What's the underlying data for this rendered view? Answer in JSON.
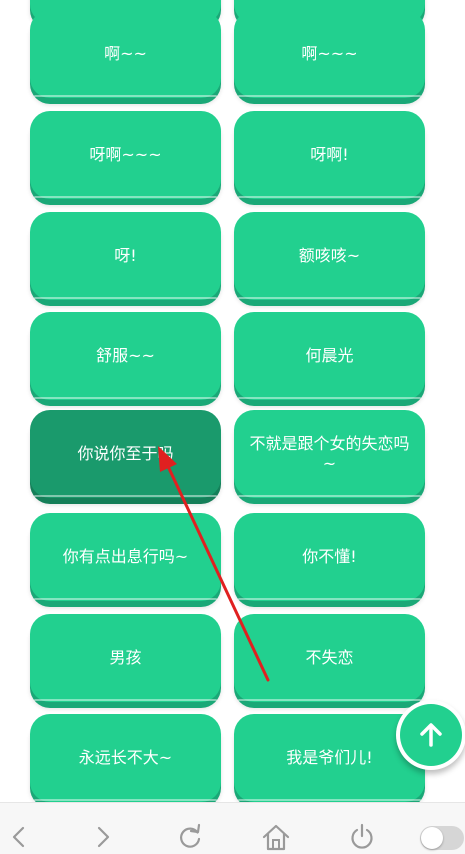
{
  "buttons": [
    {
      "label": ""
    },
    {
      "label": ""
    },
    {
      "label": "啊~~"
    },
    {
      "label": "啊~~~"
    },
    {
      "label": "呀啊~~~"
    },
    {
      "label": "呀啊!"
    },
    {
      "label": "呀!"
    },
    {
      "label": "额咳咳~"
    },
    {
      "label": "舒服~~"
    },
    {
      "label": "何晨光"
    },
    {
      "label": "你说你至于吗"
    },
    {
      "label": "不就是跟个女的失恋吗~"
    },
    {
      "label": "你有点出息行吗~"
    },
    {
      "label": "你不懂!"
    },
    {
      "label": "男孩"
    },
    {
      "label": "不失恋"
    },
    {
      "label": "永远长不大~"
    },
    {
      "label": "我是爷们儿!"
    }
  ],
  "colors": {
    "button": "#22d08f",
    "button_pressed": "#1a9a6c",
    "annotation_arrow": "#e02020"
  },
  "icons": {
    "scroll_top": "arrow-up-icon",
    "back": "chevron-left-icon",
    "forward": "chevron-right-icon",
    "reload": "reload-icon",
    "home": "home-icon",
    "power": "power-icon"
  },
  "toggle": {
    "on": false
  }
}
